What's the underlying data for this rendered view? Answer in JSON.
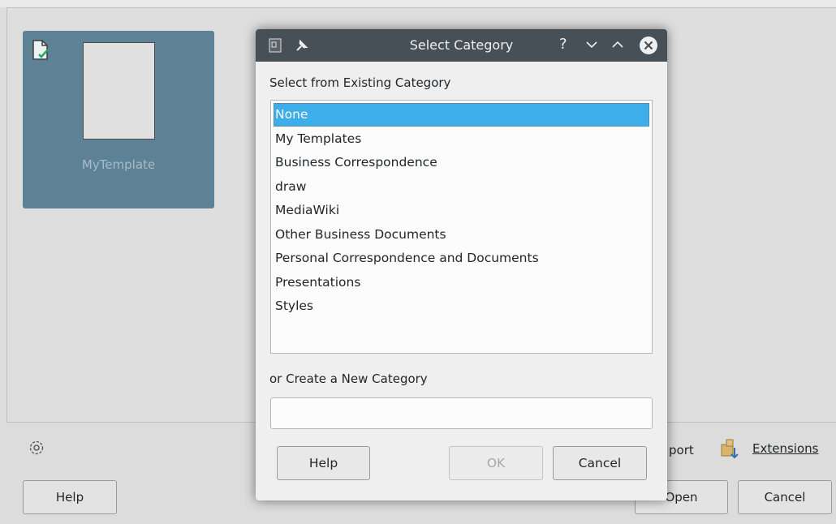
{
  "background": {
    "template": {
      "name": "MyTemplate"
    },
    "buttons": {
      "help": "Help",
      "import": "port",
      "extensions": "Extensions",
      "open": "Open",
      "cancel": "Cancel"
    }
  },
  "dialog": {
    "title": "Select Category",
    "existing_label": "Select from Existing Category",
    "new_label": "or Create a New Category",
    "new_category_value": "",
    "categories": [
      "None",
      "My Templates",
      "Business Correspondence",
      "draw",
      "MediaWiki",
      "Other Business Documents",
      "Personal Correspondence and Documents",
      "Presentations",
      "Styles"
    ],
    "selected_category": "None",
    "buttons": {
      "help": "Help",
      "ok": "OK",
      "cancel": "Cancel"
    }
  },
  "colors": {
    "selection": "#3daee9",
    "titlebar": "#475057",
    "template_tile": "#5d8296"
  }
}
